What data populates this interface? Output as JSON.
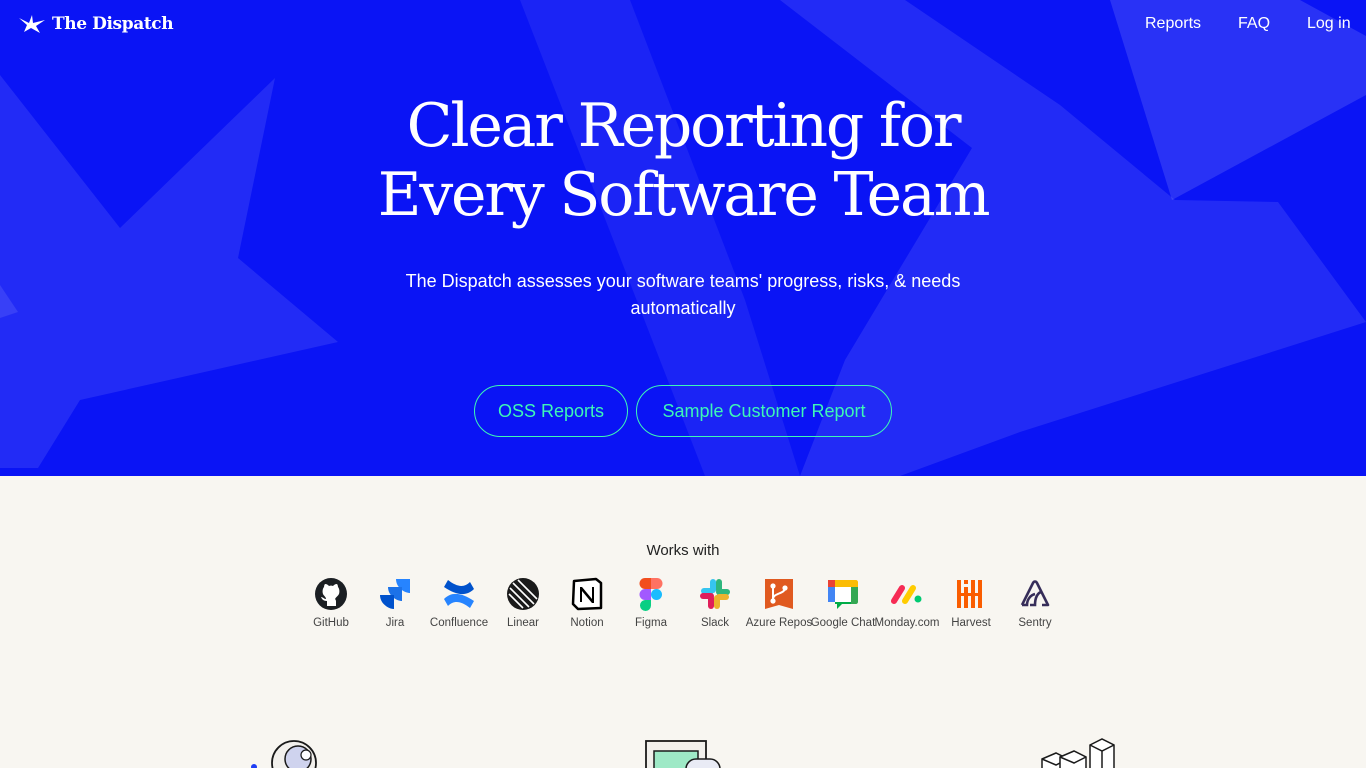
{
  "brand": {
    "name": "The Dispatch",
    "primary_color": "#0a14f5",
    "accent_color": "#3df7b6"
  },
  "nav": {
    "reports": "Reports",
    "faq": "FAQ",
    "login": "Log in"
  },
  "hero": {
    "headline_line1": "Clear Reporting for",
    "headline_line2": "Every Software Team",
    "subheadline": "The Dispatch assesses your software teams' progress, risks, & needs automatically",
    "oss_button": "OSS Reports",
    "sample_button": "Sample Customer Report"
  },
  "integrations": {
    "title": "Works with",
    "items": [
      {
        "label": "GitHub",
        "icon": "github-icon"
      },
      {
        "label": "Jira",
        "icon": "jira-icon"
      },
      {
        "label": "Confluence",
        "icon": "confluence-icon"
      },
      {
        "label": "Linear",
        "icon": "linear-icon"
      },
      {
        "label": "Notion",
        "icon": "notion-icon"
      },
      {
        "label": "Figma",
        "icon": "figma-icon"
      },
      {
        "label": "Slack",
        "icon": "slack-icon"
      },
      {
        "label": "Azure Repos",
        "icon": "azure-repos-icon"
      },
      {
        "label": "Google Chat",
        "icon": "google-chat-icon"
      },
      {
        "label": "Monday.com",
        "icon": "monday-icon"
      },
      {
        "label": "Harvest",
        "icon": "harvest-icon"
      },
      {
        "label": "Sentry",
        "icon": "sentry-icon"
      }
    ]
  }
}
